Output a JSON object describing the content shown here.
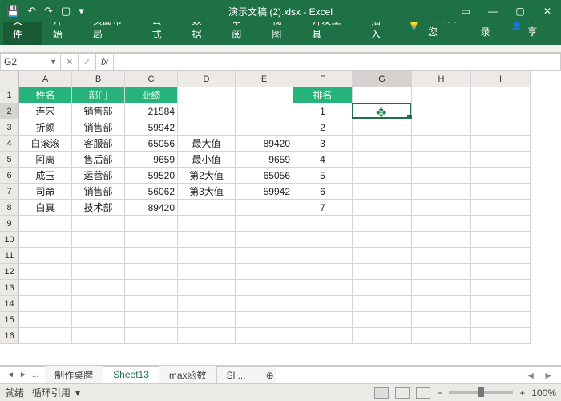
{
  "title": "演示文稿 (2).xlsx - Excel",
  "tabs": {
    "file": "文件",
    "home": "开始",
    "layout": "页面布局",
    "formula": "公式",
    "data": "数据",
    "review": "审阅",
    "view": "视图",
    "dev": "开发工具",
    "insert": "插入"
  },
  "tell_me": "告诉我您",
  "signin": "登录",
  "share": "共享",
  "name_box": "G2",
  "formula_bar": "",
  "col_labels": [
    "A",
    "B",
    "C",
    "D",
    "E",
    "F",
    "G",
    "H",
    "I"
  ],
  "row_count": 16,
  "header": {
    "A": "姓名",
    "B": "部门",
    "C": "业绩",
    "F": "排名"
  },
  "rows": [
    {
      "A": "连宋",
      "B": "销售部",
      "C": "21584",
      "F": "1"
    },
    {
      "A": "折颜",
      "B": "销售部",
      "C": "59942",
      "F": "2"
    },
    {
      "A": "白滚滚",
      "B": "客服部",
      "C": "65056",
      "D": "最大值",
      "E": "89420",
      "F": "3"
    },
    {
      "A": "阿离",
      "B": "售后部",
      "C": "9659",
      "D": "最小值",
      "E": "9659",
      "F": "4"
    },
    {
      "A": "成玉",
      "B": "运营部",
      "C": "59520",
      "D": "第2大值",
      "E": "65056",
      "F": "5"
    },
    {
      "A": "司命",
      "B": "销售部",
      "C": "56062",
      "D": "第3大值",
      "E": "59942",
      "F": "6"
    },
    {
      "A": "白真",
      "B": "技术部",
      "C": "89420",
      "F": "7"
    }
  ],
  "sheet_tabs": {
    "t1": "制作桌牌",
    "t2": "Sheet13",
    "t3": "max函数",
    "t4": "Sl ...",
    "more": "..."
  },
  "active_sheet": "Sheet13",
  "status": {
    "ready": "就绪",
    "circ": "循环引用",
    "zoom": "100%"
  },
  "selected": {
    "col": "G",
    "row": 2
  }
}
